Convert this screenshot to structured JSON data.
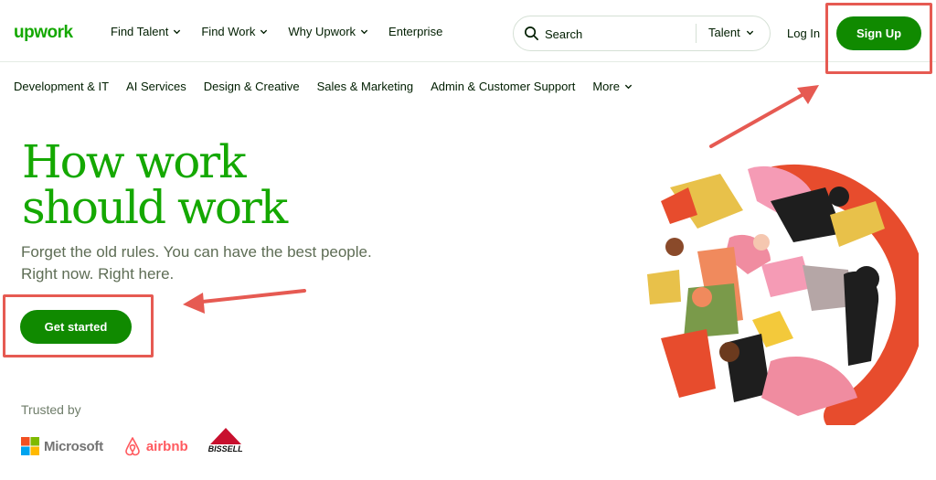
{
  "header": {
    "logo_text": "upwork",
    "nav": [
      {
        "label": "Find Talent",
        "has_dropdown": true
      },
      {
        "label": "Find Work",
        "has_dropdown": true
      },
      {
        "label": "Why Upwork",
        "has_dropdown": true
      },
      {
        "label": "Enterprise",
        "has_dropdown": false
      }
    ],
    "search": {
      "placeholder": "Search",
      "scope": "Talent"
    },
    "login_label": "Log In",
    "signup_label": "Sign Up"
  },
  "categories": [
    {
      "label": "Development & IT"
    },
    {
      "label": "AI Services"
    },
    {
      "label": "Design & Creative"
    },
    {
      "label": "Sales & Marketing"
    },
    {
      "label": "Admin & Customer Support"
    },
    {
      "label": "More",
      "has_dropdown": true
    }
  ],
  "hero": {
    "headline_line1": "How work",
    "headline_line2": "should work",
    "subtitle_line1": "Forget the old rules. You can have the best people.",
    "subtitle_line2": "Right now. Right here.",
    "cta_label": "Get started"
  },
  "trusted": {
    "label": "Trusted by",
    "brands": [
      "Microsoft",
      "airbnb",
      "BISSELL"
    ]
  },
  "colors": {
    "brand_green": "#108a00",
    "headline_green": "#14a800",
    "annotation_red": "#e65a52",
    "text_dark": "#001e00"
  }
}
